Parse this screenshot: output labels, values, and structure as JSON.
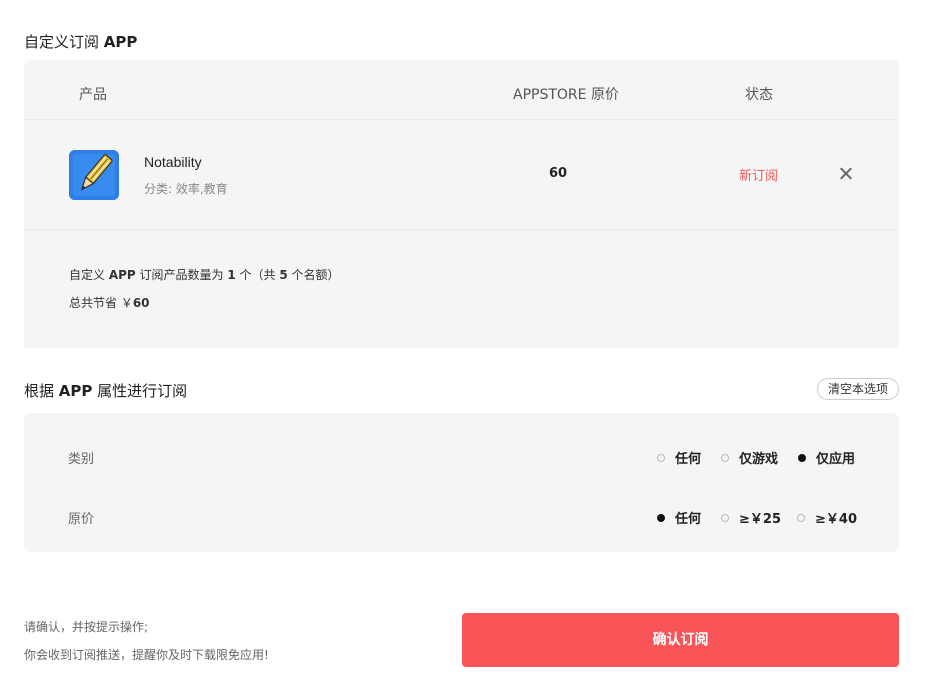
{
  "custom": {
    "title_prefix": "自定义订阅 ",
    "title_bold": "APP",
    "table": {
      "col_product": "产品",
      "col_price": "APPSTORE 原价",
      "col_status": "状态"
    },
    "apps": [
      {
        "name": "Notability",
        "category": "分类: 效率,教育",
        "price": "60",
        "status": "新订阅",
        "icon": "notability-pencil-icon"
      }
    ],
    "summary": {
      "line1_a": "自定义 ",
      "line1_b": "APP",
      "line1_c": " 订阅产品数量为 ",
      "line1_d": "1",
      "line1_e": " 个（共 ",
      "line1_f": "5",
      "line1_g": " 个名额）",
      "line2_a": "总共节省 ￥",
      "line2_b": "60"
    }
  },
  "attrs": {
    "title_prefix": "根据 ",
    "title_bold": "APP",
    "title_suffix": " 属性进行订阅",
    "clear_label": "清空本选项",
    "category": {
      "label": "类别",
      "options": [
        {
          "label": "任何",
          "selected": false
        },
        {
          "label": "仅游戏",
          "selected": false
        },
        {
          "label": "仅应用",
          "selected": true
        }
      ]
    },
    "price": {
      "label": "原价",
      "options": [
        {
          "label": "任何",
          "selected": true
        },
        {
          "label": "≥￥25",
          "selected": false
        },
        {
          "label": "≥￥40",
          "selected": false
        }
      ]
    }
  },
  "footer": {
    "note1": "请确认，并按提示操作;",
    "note2": "你会收到订阅推送，提醒你及时下载限免应用!",
    "confirm_label": "确认订阅"
  },
  "colors": {
    "accent": "#f95458",
    "status_new": "#f05a5a",
    "panel_bg": "#f5f5f5"
  }
}
